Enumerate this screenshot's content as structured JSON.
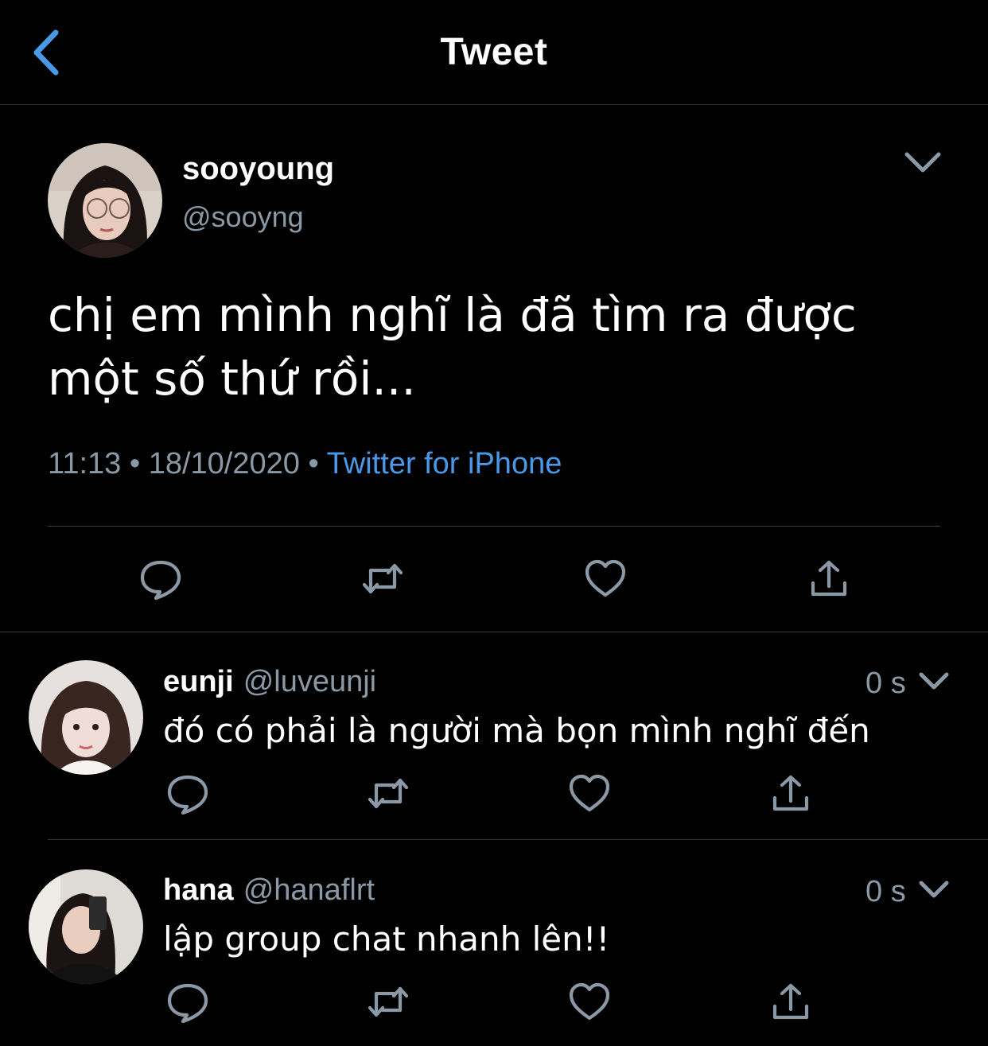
{
  "header": {
    "title": "Tweet",
    "back_icon": "chevron-left-icon"
  },
  "colors": {
    "accent": "#4a99e9",
    "secondary_text": "#8b98a5",
    "background": "#000000"
  },
  "main_tweet": {
    "name": "sooyoung",
    "handle": "@sooyng",
    "text": "chị em mình nghĩ là đã tìm ra được một số thứ rồi...",
    "time": "11:13",
    "date": "18/10/2020",
    "source": "Twitter for iPhone",
    "separator": "•",
    "actions": [
      "reply-icon",
      "retweet-icon",
      "like-icon",
      "share-icon"
    ]
  },
  "replies": [
    {
      "name": "eunji",
      "handle": "@luveunji",
      "time": "0 s",
      "text": "đó có phải là người mà bọn mình nghĩ đến"
    },
    {
      "name": "hana",
      "handle": "@hanaflrt",
      "time": "0 s",
      "text": "lập group chat nhanh lên!!"
    }
  ]
}
